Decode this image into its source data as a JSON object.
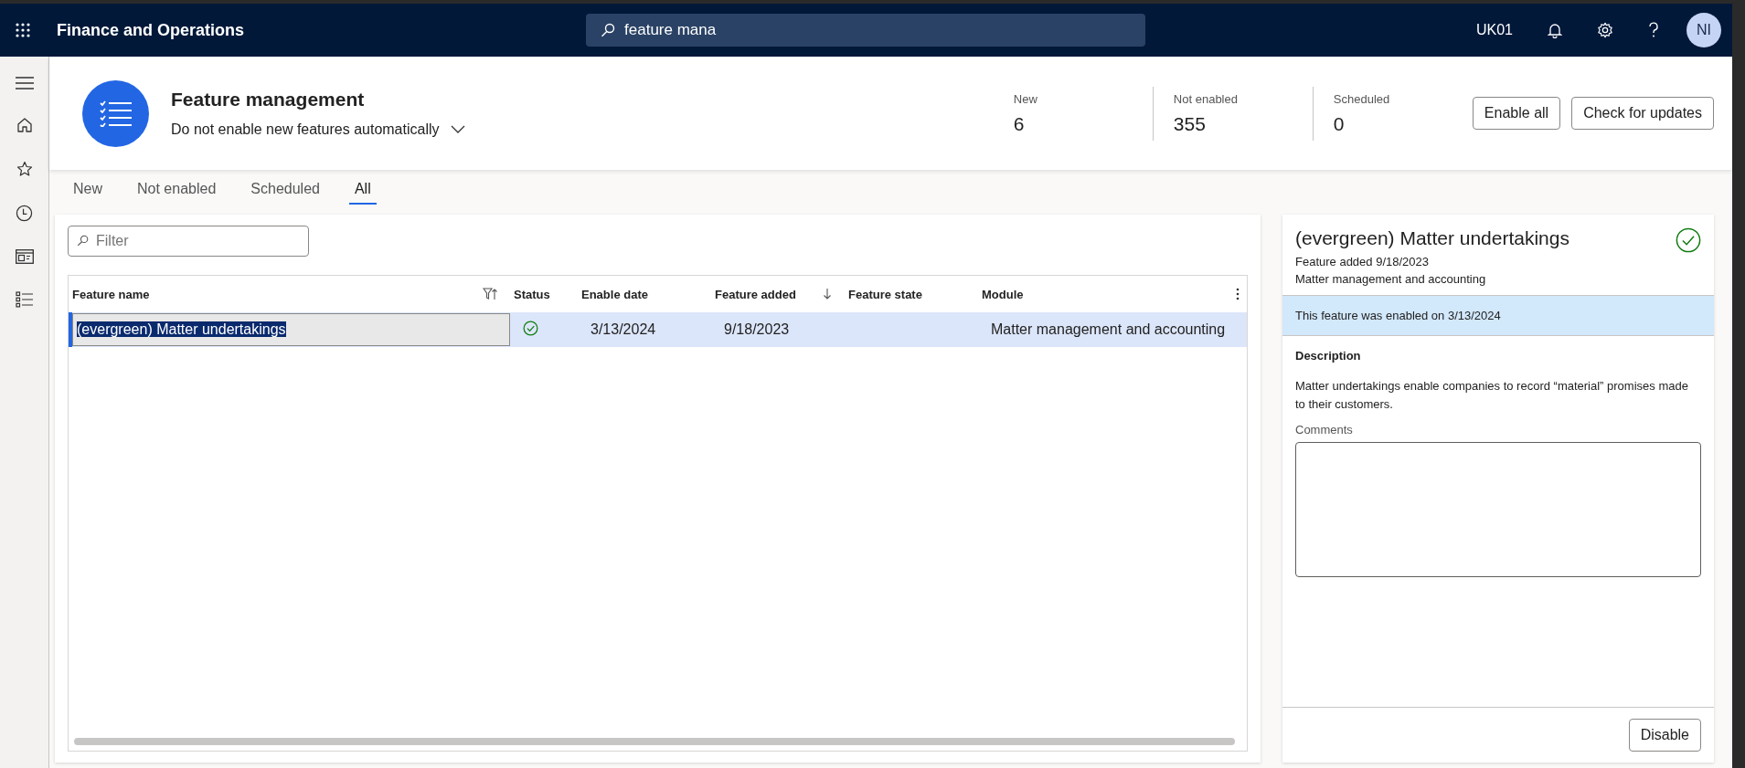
{
  "app": {
    "title": "Finance and Operations",
    "search": {
      "value": "feature mana"
    },
    "company": "UK01",
    "avatar": "NI"
  },
  "header": {
    "title": "Feature management",
    "auto_enable": "Do not enable new features automatically",
    "stats": [
      {
        "label": "New",
        "value": "6"
      },
      {
        "label": "Not enabled",
        "value": "355"
      },
      {
        "label": "Scheduled",
        "value": "0"
      }
    ],
    "buttons": [
      "Enable all",
      "Check for updates"
    ]
  },
  "tabs": [
    {
      "label": "New",
      "selected": false
    },
    {
      "label": "Not enabled",
      "selected": false
    },
    {
      "label": "Scheduled",
      "selected": false
    },
    {
      "label": "All",
      "selected": true
    }
  ],
  "filter": {
    "placeholder": "Filter"
  },
  "table": {
    "columns": [
      {
        "label": "Feature name",
        "filtered": true,
        "sorted": false
      },
      {
        "label": "Status",
        "filtered": false,
        "sorted": false
      },
      {
        "label": "Enable date",
        "filtered": false,
        "sorted": false
      },
      {
        "label": "Feature added",
        "filtered": false,
        "sorted": true
      },
      {
        "label": "Feature state",
        "filtered": false,
        "sorted": false
      },
      {
        "label": "Module",
        "filtered": false,
        "sorted": false
      }
    ],
    "rows": [
      {
        "selected": true,
        "name": "(evergreen) Matter undertakings",
        "enabled": true,
        "enable_date": "3/13/2024",
        "feature_added": "9/18/2023",
        "module": "Matter management and accounting"
      }
    ]
  },
  "detail": {
    "title": "(evergreen) Matter undertakings",
    "enabled": true,
    "added": "Feature added 9/18/2023",
    "module": "Matter management and accounting",
    "notice": "This feature was enabled on 3/13/2024",
    "description_label": "Description",
    "description": "Matter undertakings enable companies to record “material” promises made to their customers.",
    "comments_label": "Comments",
    "button": "Disable"
  }
}
